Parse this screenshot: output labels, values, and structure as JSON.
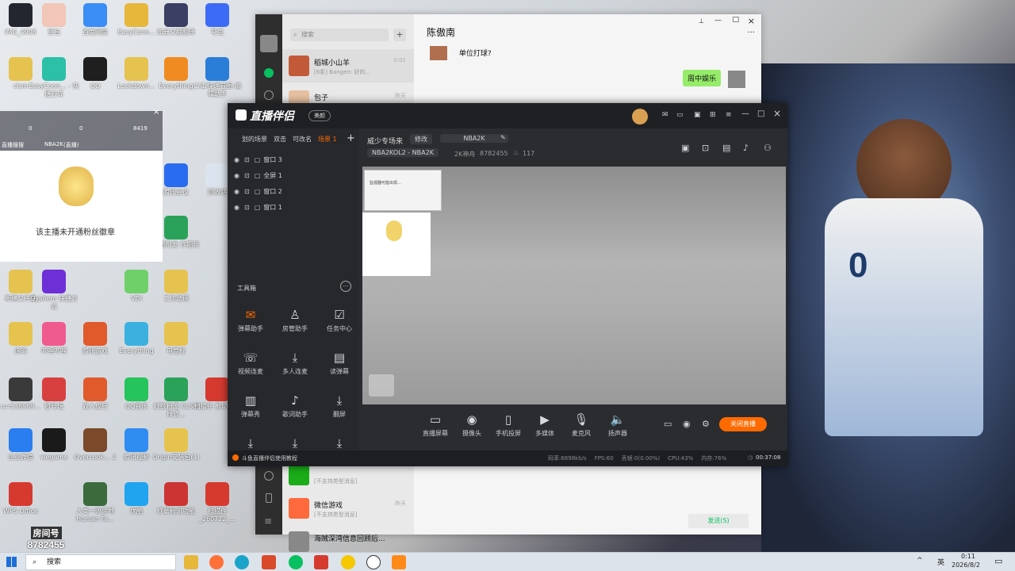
{
  "desktop": {
    "icons": [
      {
        "label": "IMG_4908",
        "color": "#23262e"
      },
      {
        "label": "豆包",
        "color": "#f2c6b8"
      },
      {
        "label": "百度网盘",
        "color": "#3a8ef6"
      },
      {
        "label": "EasyConn...",
        "color": "#e7b73b"
      },
      {
        "label": "知云文献翻译",
        "color": "#3b3f63"
      },
      {
        "label": "夸克",
        "color": "#3c6cf5"
      },
      {
        "label": "clsm",
        "color": "#e6c24f"
      },
      {
        "label": "EasyConn... - 快捷方式",
        "color": "#2cc0a8"
      },
      {
        "label": "QQ",
        "color": "#1f1f1f"
      },
      {
        "label": "Lockdown...",
        "color": "#e6c24f"
      },
      {
        "label": "Everything",
        "color": "#f08b22"
      },
      {
        "label": "CAD快速看图-编辑助手",
        "color": "#2a7ed8"
      },
      {
        "label": "腾讯会议",
        "color": "#2a6cf0"
      },
      {
        "label": "回收站",
        "color": "#dbe4ee"
      },
      {
        "label": "南番剂发 作期限",
        "color": "#2ba25a"
      },
      {
        "label": "新建文件夹",
        "color": "#e6c24f"
      },
      {
        "label": "Qyjdiem 快捷方式",
        "color": "#6d2fd6"
      },
      {
        "label": "VDI",
        "color": "#6fd06a"
      },
      {
        "label": "工作助理",
        "color": "#e6c24f"
      },
      {
        "label": "哔哩哔哩",
        "color": "#f05b8f"
      },
      {
        "label": "QQ音乐",
        "color": "#25c45c"
      },
      {
        "label": "wegame",
        "color": "#1a1a1a"
      },
      {
        "label": "Overcook... 2",
        "color": "#7a4a2a"
      },
      {
        "label": "腾讯视频",
        "color": "#2f8cf0"
      },
      {
        "label": "Origin安装包(1)",
        "color": "#e6c24f"
      },
      {
        "label": "企业微信",
        "color": "#2a7ef0"
      },
      {
        "label": "WPS Office",
        "color": "#d63a2f"
      },
      {
        "label": "人类一败涂地 Human Fa...",
        "color": "#3c6a3c"
      },
      {
        "label": "优酷",
        "color": "#1fa4f0"
      },
      {
        "label": "红蘑粉流功能",
        "color": "#c33"
      },
      {
        "label": "扫描件_260722_...",
        "color": "#d63a2f"
      },
      {
        "label": "u=536989...",
        "color": "#3a3a3a"
      },
      {
        "label": "租号玩",
        "color": "#d84040"
      },
      {
        "label": "双人成行",
        "color": "#e05a2c"
      },
      {
        "label": "红鼓粉流 CLSM样式...",
        "color": "#2ba25a"
      },
      {
        "label": "扫描件 剪切文档",
        "color": "#d63a2f"
      },
      {
        "label": "这的",
        "color": "#e6c24f"
      },
      {
        "label": "腾讯游戏",
        "color": "#e05a2c"
      },
      {
        "label": "Everything",
        "color": "#3bb1e0"
      },
      {
        "label": "电竞标",
        "color": "#e6c24f"
      }
    ],
    "room_label": "房间号",
    "room_number": "8782455",
    "fan_message": "该主播未开通粉丝徽章",
    "overlay_counts": [
      "0",
      "0",
      "8419"
    ],
    "overlay_labels": [
      "直播搜搜",
      "NBA2K",
      "(直播)"
    ]
  },
  "wechat": {
    "search_placeholder": "搜索",
    "add_label": "+",
    "chat_title": "陈傲南",
    "more_label": "···",
    "contacts": [
      {
        "name": "稻城小山羊",
        "preview": "[6条] Bangen: 好的...",
        "time": "0:01",
        "color": "#c25a3a"
      },
      {
        "name": "包子",
        "preview": "",
        "time": "昨天",
        "color": "#e6c0a0"
      },
      {
        "name": "",
        "preview": "[不支持类型消息]",
        "time": "",
        "color": "#1aad19"
      },
      {
        "name": "微信游戏",
        "preview": "[不支持类型消息]",
        "time": "昨天",
        "color": "#ff6a3c"
      },
      {
        "name": "海贼深湾信息回顾后...",
        "preview": "",
        "time": "",
        "color": "#888"
      }
    ],
    "messages": [
      {
        "text": "单位打球?",
        "side": "left"
      },
      {
        "text": "周中娱乐",
        "side": "right"
      }
    ],
    "send_label": "发送(S)"
  },
  "obs": {
    "app_title": "直播伴侣",
    "badge": "美颜",
    "scene_tabs": [
      "划的场景",
      "双击",
      "可改名",
      "场景 1"
    ],
    "add_scene": "+",
    "sources": [
      {
        "name": "窗口 3"
      },
      {
        "name": "全屏 1"
      },
      {
        "name": "窗口 2"
      },
      {
        "name": "窗口 1"
      }
    ],
    "tools_title": "工具箱",
    "tools": [
      {
        "label": "弹幕助手",
        "icon": "✉"
      },
      {
        "label": "房管助手",
        "icon": "♙"
      },
      {
        "label": "任务中心",
        "icon": "☑"
      },
      {
        "label": "视频连麦",
        "icon": "☏"
      },
      {
        "label": "多人连麦",
        "icon": "⤓"
      },
      {
        "label": "读弹幕",
        "icon": "▤"
      },
      {
        "label": "弹幕秀",
        "icon": "▥"
      },
      {
        "label": "歌词助手",
        "icon": "♪"
      },
      {
        "label": "翻屏",
        "icon": "⤓"
      },
      {
        "label": "",
        "icon": "⤓"
      },
      {
        "label": "",
        "icon": "⤓"
      },
      {
        "label": "",
        "icon": "⤓"
      }
    ],
    "room_title": "威少专场来",
    "edit_label": "修改",
    "game_label": "NBA2K",
    "category": "NBA2KOL2 - NBA2K",
    "hot_label": "2K神舟",
    "room_id": "8782455",
    "heat": "117",
    "controls": [
      {
        "label": "直播屏幕",
        "icon": "▭"
      },
      {
        "label": "摄像头",
        "icon": "◉"
      },
      {
        "label": "手机投屏",
        "icon": "▯"
      },
      {
        "label": "多媒体",
        "icon": "▶"
      },
      {
        "label": "麦克风",
        "icon": "🎙"
      },
      {
        "label": "扬声器",
        "icon": "🔈"
      }
    ],
    "stop_label": "关闭直播",
    "tutorial": "斗鱼直播伴侣使用教程",
    "stats": [
      "码率:6898kb/s",
      "FPS:60",
      "丢帧:0(0.00%)",
      "CPU:43%",
      "内存:76%"
    ],
    "timer": "00:37:08",
    "dialog_text": "监视器可能出现...",
    "accent": "#ff6a00"
  },
  "taskbar": {
    "search_placeholder": "搜索",
    "lang": "英",
    "time": "0:11",
    "date": "2026/8/2"
  }
}
